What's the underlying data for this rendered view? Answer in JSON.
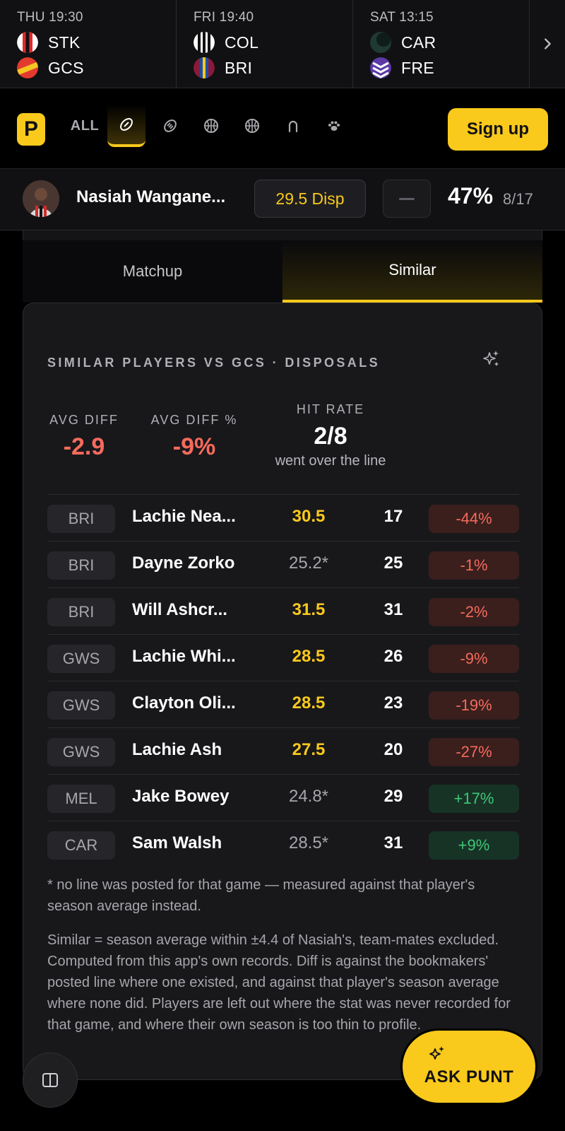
{
  "fixtures": [
    {
      "time": "THU 19:30",
      "home": "STK",
      "away": "GCS"
    },
    {
      "time": "FRI 19:40",
      "home": "COL",
      "away": "BRI"
    },
    {
      "time": "SAT 13:15",
      "home": "CAR",
      "away": "FRE"
    }
  ],
  "nav": {
    "brand_letter": "P",
    "all_label": "ALL",
    "signup_label": "Sign up"
  },
  "player": {
    "name": "Nasiah Wangane...",
    "line_label": "29.5 Disp",
    "hit_pct": "47%",
    "hit_frac": "8/17"
  },
  "tabs": [
    {
      "label": "Matchup",
      "active": false
    },
    {
      "label": "Similar",
      "active": true
    }
  ],
  "card": {
    "title": "SIMILAR PLAYERS VS GCS · DISPOSALS",
    "avg_diff_label": "AVG DIFF",
    "avg_diff_value": "-2.9",
    "avg_diff_pct_label": "AVG DIFF %",
    "avg_diff_pct_value": "-9%",
    "hit_rate_label": "HIT RATE",
    "hit_rate_value": "2/8",
    "hit_rate_sub": "went over the line",
    "rows": [
      {
        "team": "BRI",
        "name": "Lachie Nea...",
        "line": "30.5",
        "posted": true,
        "actual": "17",
        "diff": "-44%",
        "positive": false
      },
      {
        "team": "BRI",
        "name": "Dayne Zorko",
        "line": "25.2*",
        "posted": false,
        "actual": "25",
        "diff": "-1%",
        "positive": false
      },
      {
        "team": "BRI",
        "name": "Will Ashcr...",
        "line": "31.5",
        "posted": true,
        "actual": "31",
        "diff": "-2%",
        "positive": false
      },
      {
        "team": "GWS",
        "name": "Lachie Whi...",
        "line": "28.5",
        "posted": true,
        "actual": "26",
        "diff": "-9%",
        "positive": false
      },
      {
        "team": "GWS",
        "name": "Clayton Oli...",
        "line": "28.5",
        "posted": true,
        "actual": "23",
        "diff": "-19%",
        "positive": false
      },
      {
        "team": "GWS",
        "name": "Lachie Ash",
        "line": "27.5",
        "posted": true,
        "actual": "20",
        "diff": "-27%",
        "positive": false
      },
      {
        "team": "MEL",
        "name": "Jake Bowey",
        "line": "24.8*",
        "posted": false,
        "actual": "29",
        "diff": "+17%",
        "positive": true
      },
      {
        "team": "CAR",
        "name": "Sam Walsh",
        "line": "28.5*",
        "posted": false,
        "actual": "31",
        "diff": "+9%",
        "positive": true
      }
    ],
    "footnote": "* no line was posted for that game — measured against that player's season average instead.",
    "method": "Similar = season average within ±4.4 of Nasiah's, team-mates excluded. Computed from this app's own records. Diff is against the bookmakers' posted line where one existed, and against that player's season average where none did. Players are left out where the stat was never recorded for that game, and where their own season is too thin to profile."
  },
  "ask_punt_label": "ASK PUNT",
  "colors": {
    "accent": "#f9c91c",
    "negative": "#f66a5c",
    "positive": "#3fc776",
    "background": "#000000",
    "card": "#18181b"
  }
}
